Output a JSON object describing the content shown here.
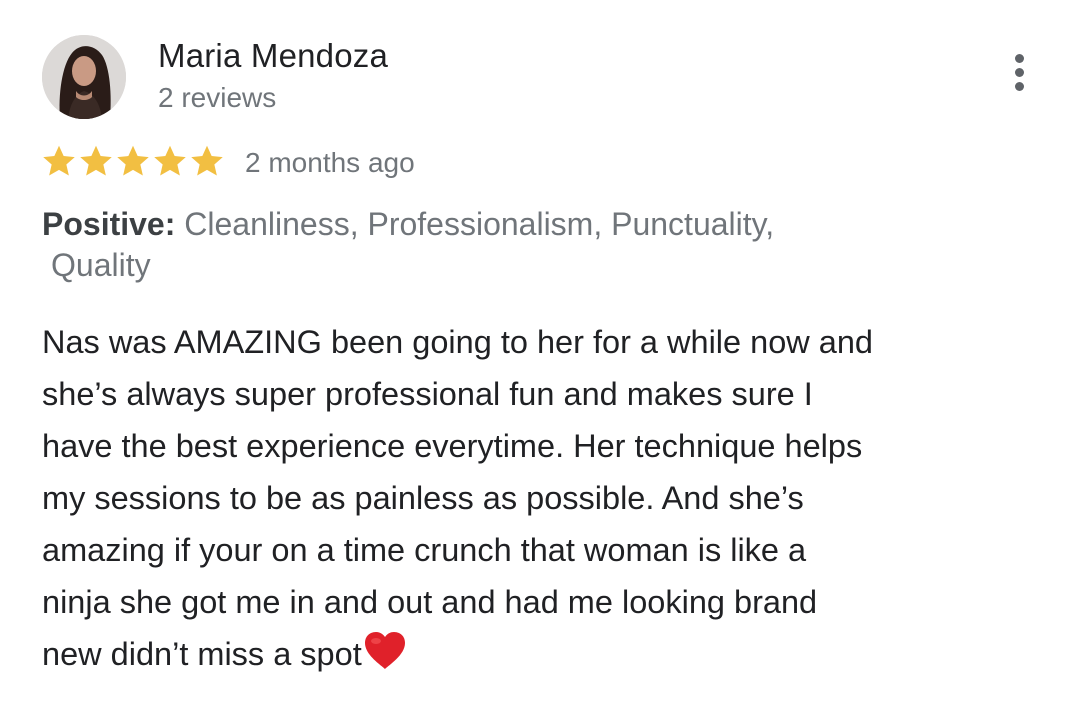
{
  "review": {
    "author_name": "Maria Mendoza",
    "review_count": "2 reviews",
    "rating": 5,
    "rating_max": 5,
    "date": "2 months ago",
    "positive_label": "Positive:",
    "positive_line1": "Cleanliness, Professionalism, Punctuality,",
    "positive_line2": "Quality",
    "text_lines": [
      "Nas was AMAZING been going to her for a while now and",
      "she’s always super professional fun and makes sure I",
      "have the best experience everytime. Her technique helps",
      "my sessions to be as painless as possible. And she’s",
      "amazing if your on a time crunch that woman is like a",
      "ninja she got me in and out and had me looking brand",
      "new didn’t miss a spot"
    ],
    "text_end_emoji": "heart-emoji"
  },
  "icons": {
    "more": "more-vert-icon",
    "star": "star-icon"
  },
  "colors": {
    "star": "#f2bf42",
    "heart": "#e0212a",
    "name": "#202124",
    "secondary": "#70757a",
    "label": "#3c4043"
  }
}
